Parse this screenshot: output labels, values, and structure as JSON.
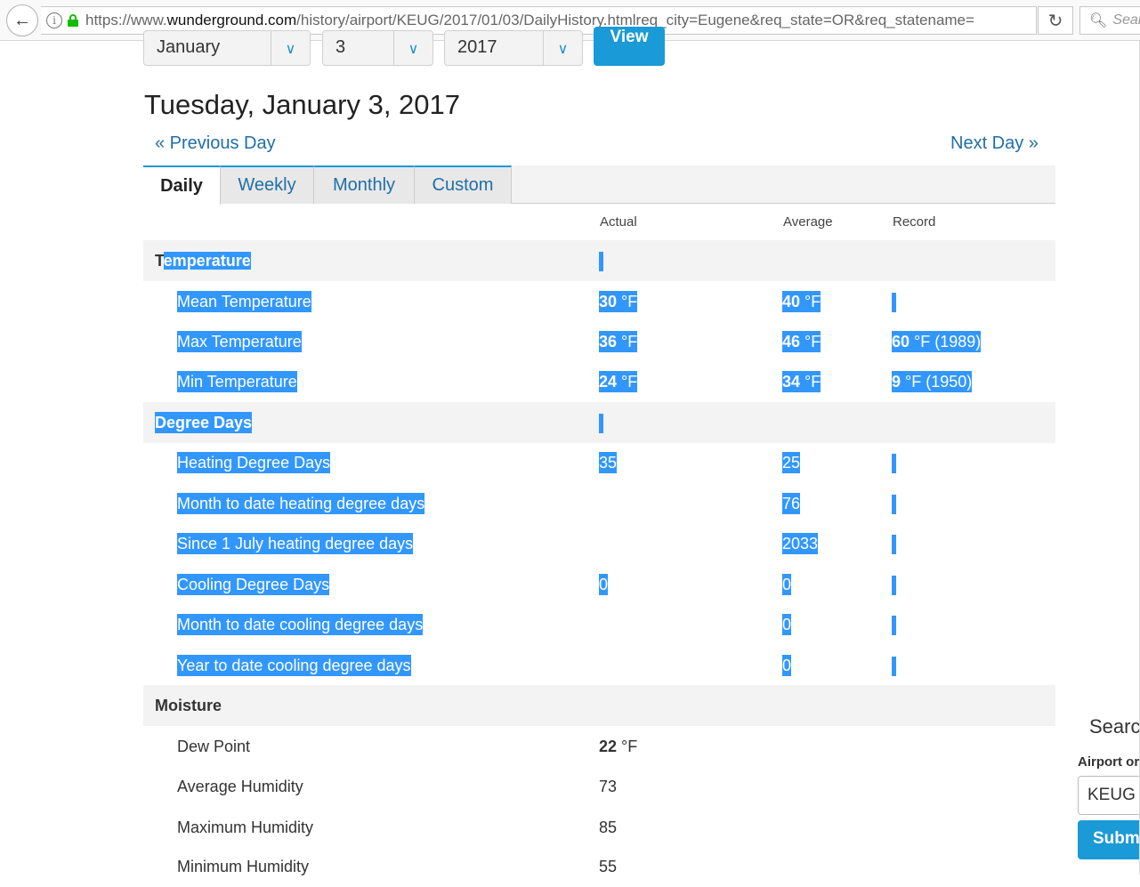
{
  "browser": {
    "url_prefix": "https://www.",
    "url_host": "wunderground.com",
    "url_path": "/history/airport/KEUG/2017/01/03/DailyHistory.htmlreq_city=Eugene&req_state=OR&req_statename=",
    "search_placeholder": "Sear"
  },
  "date_selector": {
    "month": "January",
    "day": "3",
    "year": "2017",
    "view_label": "View"
  },
  "page": {
    "title": "Tuesday, January 3, 2017",
    "prev_label": "« Previous Day",
    "next_label": "Next Day »"
  },
  "tabs": [
    {
      "label": "Daily"
    },
    {
      "label": "Weekly"
    },
    {
      "label": "Monthly"
    },
    {
      "label": "Custom"
    }
  ],
  "columns": {
    "actual": "Actual",
    "average": "Average",
    "record": "Record"
  },
  "rows": {
    "temperature": {
      "label_a": "T",
      "label_b": "emperature"
    },
    "mean_temp": {
      "label": "Mean Temperature",
      "actual_num": "30",
      "actual_unit": " °F",
      "average_num": "40",
      "average_unit": " °F"
    },
    "max_temp": {
      "label": "Max Temperature",
      "actual_num": "36",
      "actual_unit": " °F",
      "average_num": "46",
      "average_unit": " °F",
      "record_num": "60",
      "record_unit": " °F (1989)"
    },
    "min_temp": {
      "label": "Min Temperature",
      "actual_num": "24",
      "actual_unit": " °F",
      "average_num": "34",
      "average_unit": " °F",
      "record_num": "9",
      "record_unit": " °F (1950)"
    },
    "degree_days": {
      "label": "Degree Days"
    },
    "heating_dd": {
      "label": "Heating Degree Days",
      "actual": "35",
      "average": "25"
    },
    "mtd_heating": {
      "label": "Month to date heating degree days",
      "average": "76"
    },
    "since_july_heating": {
      "label": "Since 1 July heating degree days",
      "average": "2033"
    },
    "cooling_dd": {
      "label": "Cooling Degree Days",
      "actual": "0",
      "average": "0"
    },
    "mtd_cooling": {
      "label": "Month to date cooling degree days",
      "average": "0"
    },
    "ytd_cooling": {
      "label": "Year to date cooling degree days",
      "average": "0"
    },
    "moisture": {
      "label": "Moisture"
    },
    "dew_point": {
      "label": "Dew Point",
      "actual_num": "22",
      "actual_unit": " °F"
    },
    "avg_humidity": {
      "label": "Average Humidity",
      "actual": "73"
    },
    "max_humidity": {
      "label": "Maximum Humidity",
      "actual": "85"
    },
    "min_humidity": {
      "label": "Minimum Humidity",
      "actual": "55"
    }
  },
  "side_search": {
    "title": "Searc",
    "label": "Airport or",
    "value": "KEUG",
    "submit": "Subm"
  },
  "colors": {
    "accent": "#1a9ad6",
    "selection": "#3297fd",
    "link": "#1f6fa8"
  }
}
